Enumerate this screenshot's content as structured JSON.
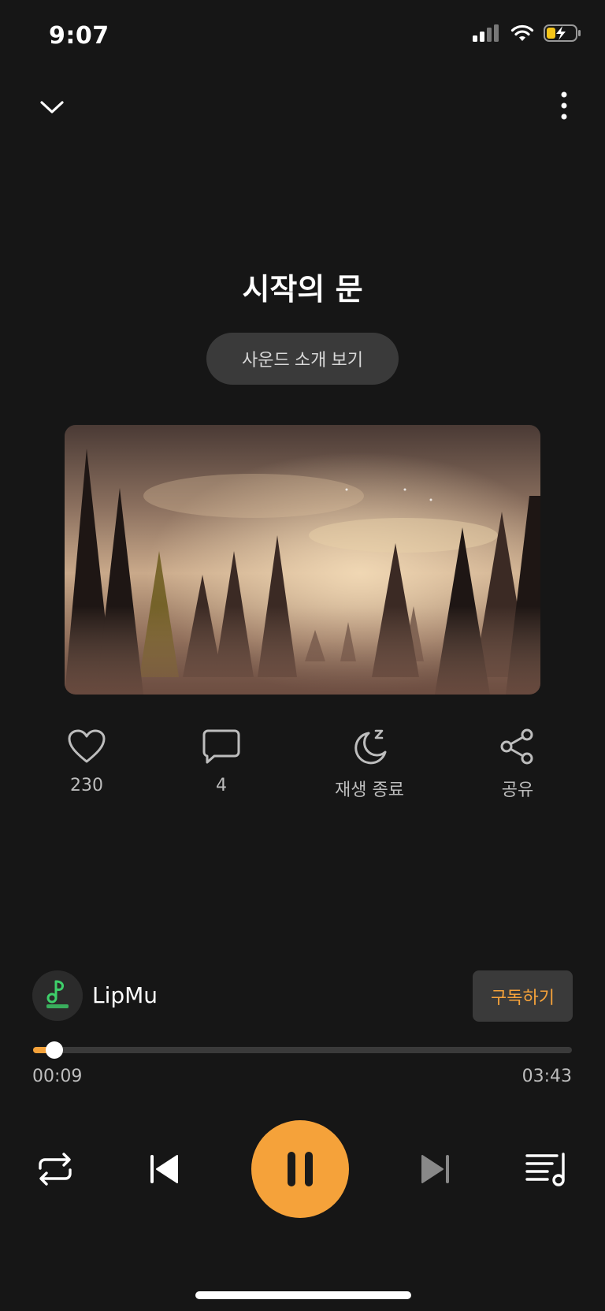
{
  "status_bar": {
    "time": "9:07"
  },
  "track": {
    "title": "시작의 문",
    "intro_button": "사운드 소개 보기"
  },
  "actions": [
    {
      "icon": "heart-icon",
      "label": "230"
    },
    {
      "icon": "comment-icon",
      "label": "4"
    },
    {
      "icon": "sleep-timer-icon",
      "label": "재생 종료"
    },
    {
      "icon": "share-icon",
      "label": "공유"
    }
  ],
  "channel": {
    "name": "LipMu",
    "subscribe_label": "구독하기"
  },
  "progress": {
    "current": "00:09",
    "total": "03:43",
    "fraction": 0.04
  },
  "colors": {
    "accent": "#f5a23a",
    "background": "#161616"
  }
}
